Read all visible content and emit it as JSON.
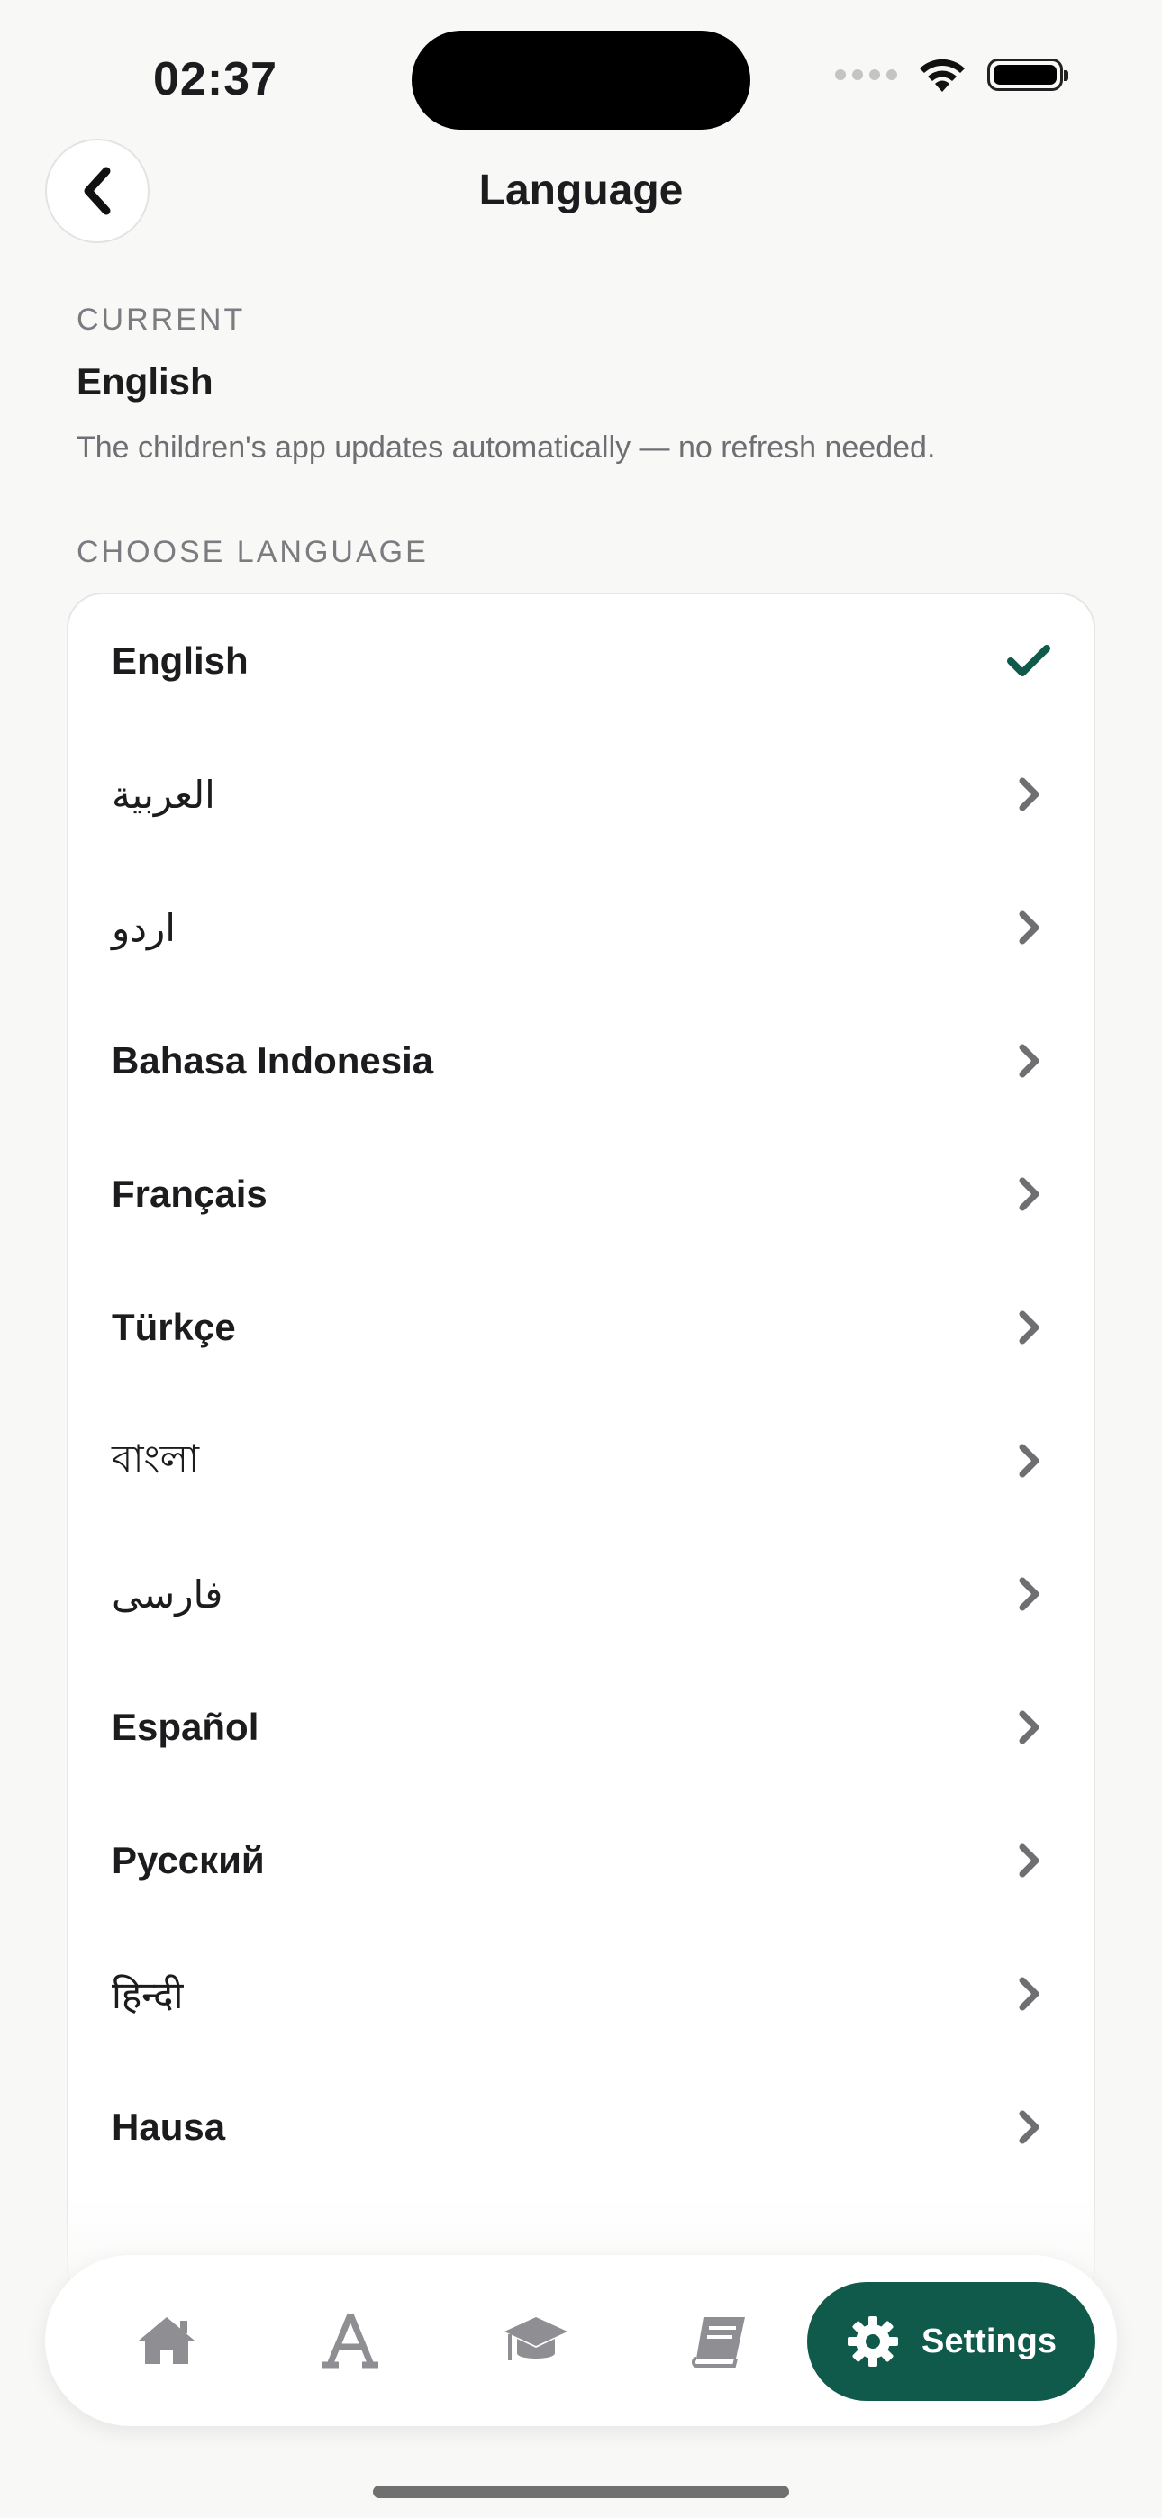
{
  "status_bar": {
    "time": "02:37"
  },
  "header": {
    "title": "Language"
  },
  "current": {
    "section_label": "CURRENT",
    "value": "English",
    "note": "The children's app updates automatically — no refresh needed."
  },
  "choose": {
    "section_label": "CHOOSE LANGUAGE",
    "languages": [
      {
        "label": "English",
        "selected": true
      },
      {
        "label": "العربية",
        "selected": false
      },
      {
        "label": "اردو",
        "selected": false
      },
      {
        "label": "Bahasa Indonesia",
        "selected": false
      },
      {
        "label": "Français",
        "selected": false
      },
      {
        "label": "Türkçe",
        "selected": false
      },
      {
        "label": "বাংলা",
        "selected": false
      },
      {
        "label": "فارسی",
        "selected": false
      },
      {
        "label": "Español",
        "selected": false
      },
      {
        "label": "Русский",
        "selected": false
      },
      {
        "label": "हिन्दी",
        "selected": false
      },
      {
        "label": "Hausa",
        "selected": false
      }
    ]
  },
  "nav": {
    "items": [
      {
        "icon": "home-icon"
      },
      {
        "icon": "alphabet-icon"
      },
      {
        "icon": "graduation-cap-icon"
      },
      {
        "icon": "book-icon"
      }
    ],
    "active": {
      "icon": "gear-icon",
      "label": "Settings"
    }
  },
  "colors": {
    "accent": "#0f5a4a",
    "inactive_icon": "#8e8e93",
    "chevron": "#6e6e73"
  }
}
